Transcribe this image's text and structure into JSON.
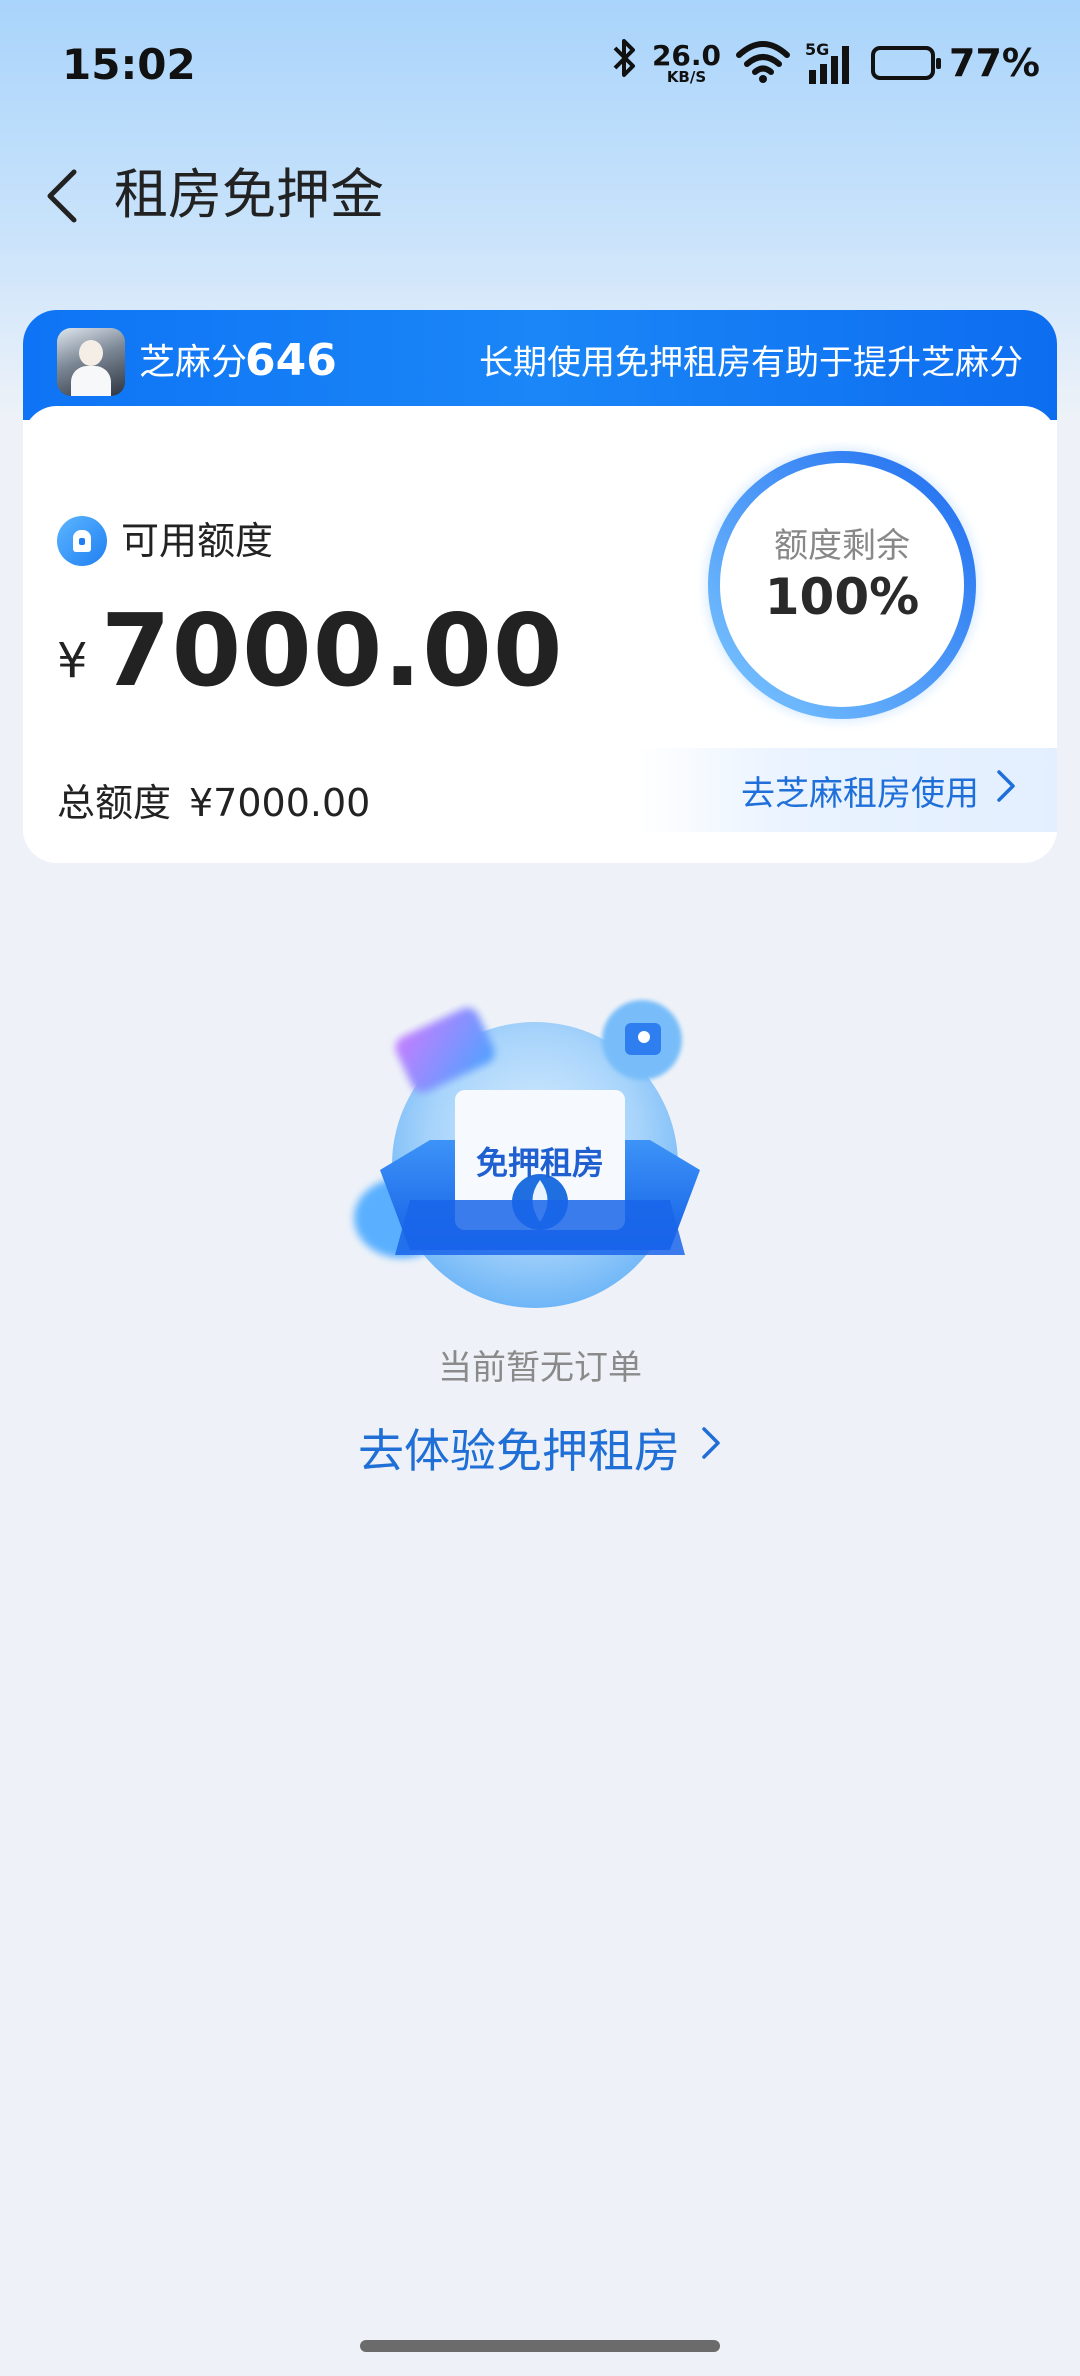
{
  "status_bar": {
    "time": "15:02",
    "net_speed_value": "26.0",
    "net_speed_unit": "KB/S",
    "signal_label": "5G",
    "battery_percent": "77%",
    "battery_level": 0.77
  },
  "nav": {
    "title": "租房免押金"
  },
  "card": {
    "sesame_label": "芝麻分",
    "sesame_score": "646",
    "header_tip": "长期使用免押租房有助于提升芝麻分",
    "available_label": "可用额度",
    "currency_symbol": "¥",
    "available_amount": "7000.00",
    "total_label": "总额度",
    "total_value": "¥7000.00",
    "ring_label": "额度剩余",
    "ring_percent": "100%",
    "ring_fraction": 1.0,
    "use_link": "去芝麻租房使用"
  },
  "empty_state": {
    "badge_text": "免押租房",
    "message": "当前暂无订单",
    "cta": "去体验免押租房"
  },
  "colors": {
    "accent": "#1f6fd6",
    "header_blue": "#0e74f5",
    "background": "#eef2f8"
  }
}
